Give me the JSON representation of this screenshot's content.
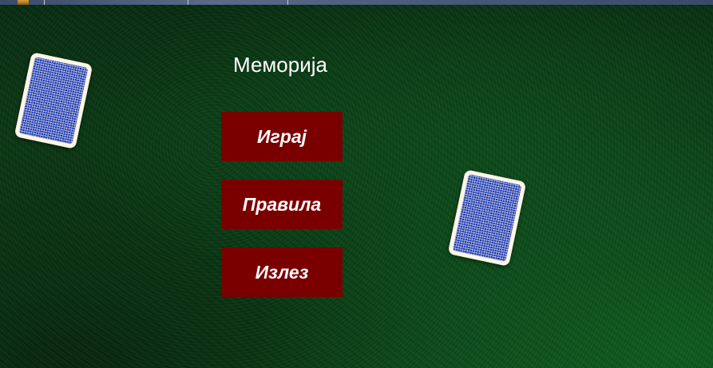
{
  "game": {
    "title": "Меморија",
    "menu": {
      "play_label": "Играј",
      "rules_label": "Правила",
      "exit_label": "Излез"
    }
  },
  "colors": {
    "table_green": "#0a3d15",
    "button_red": "#7a0000",
    "card_back_blue": "#1f3fb8",
    "card_border": "#fdf6e6"
  },
  "icons": [
    "card-back-icon"
  ]
}
